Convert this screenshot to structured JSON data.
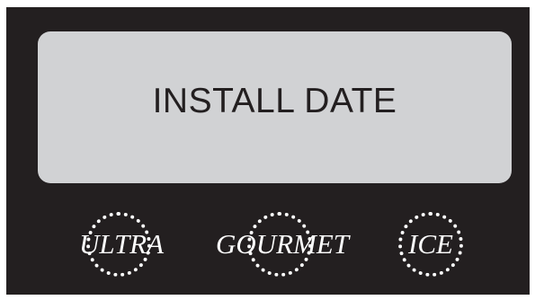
{
  "display": {
    "message": "INSTALL DATE"
  },
  "buttons": [
    {
      "label": "ULTRA"
    },
    {
      "label": "GOURMET"
    },
    {
      "label": "ICE"
    }
  ],
  "colors": {
    "panel": "#231f20",
    "display_background": "#d1d2d4",
    "display_text": "#231f20",
    "button_text": "#ffffff",
    "ring": "#ffffff"
  }
}
